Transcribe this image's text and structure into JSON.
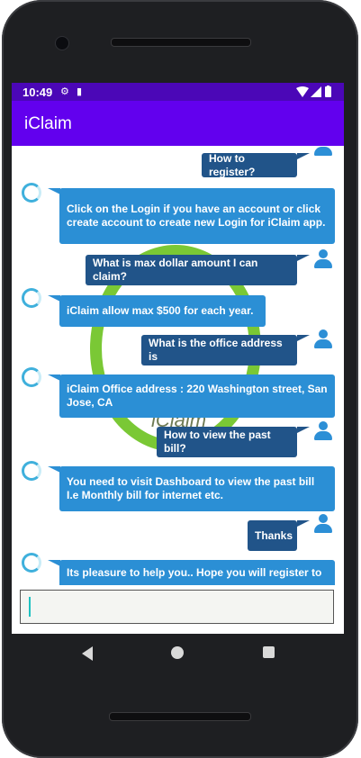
{
  "status_bar": {
    "time": "10:49",
    "icons": [
      "gear-icon",
      "sd-card-icon",
      "wifi-icon",
      "signal-icon",
      "battery-icon"
    ]
  },
  "app": {
    "title": "iClaim"
  },
  "watermark": {
    "text": "iClaim"
  },
  "messages": [
    {
      "sender": "user",
      "text": "How to register?"
    },
    {
      "sender": "bot",
      "text": "Click on the Login if you have an account or click create account to create new Login for iClaim app."
    },
    {
      "sender": "user",
      "text": "What is max dollar amount I can claim?"
    },
    {
      "sender": "bot",
      "text": "iClaim allow max $500 for each year."
    },
    {
      "sender": "user",
      "text": "What is the office address is"
    },
    {
      "sender": "bot",
      "text": "iClaim Office address : 220 Washington street, San Jose, CA"
    },
    {
      "sender": "user",
      "text": "How to view the past bill?"
    },
    {
      "sender": "bot",
      "text": "You need to visit Dashboard to view the past bill I.e Monthly bill for internet etc."
    },
    {
      "sender": "user",
      "text": "Thanks"
    },
    {
      "sender": "bot",
      "text": "Its pleasure to help you.. Hope you will register to"
    }
  ],
  "input": {
    "value": "",
    "placeholder": ""
  },
  "colors": {
    "status_bar": "#4b07b7",
    "app_bar": "#6200ee",
    "bot_bubble": "#2b8fd5",
    "user_bubble": "#215489",
    "avatar": "#3fb0dc",
    "watermark": "#6cc21f"
  }
}
